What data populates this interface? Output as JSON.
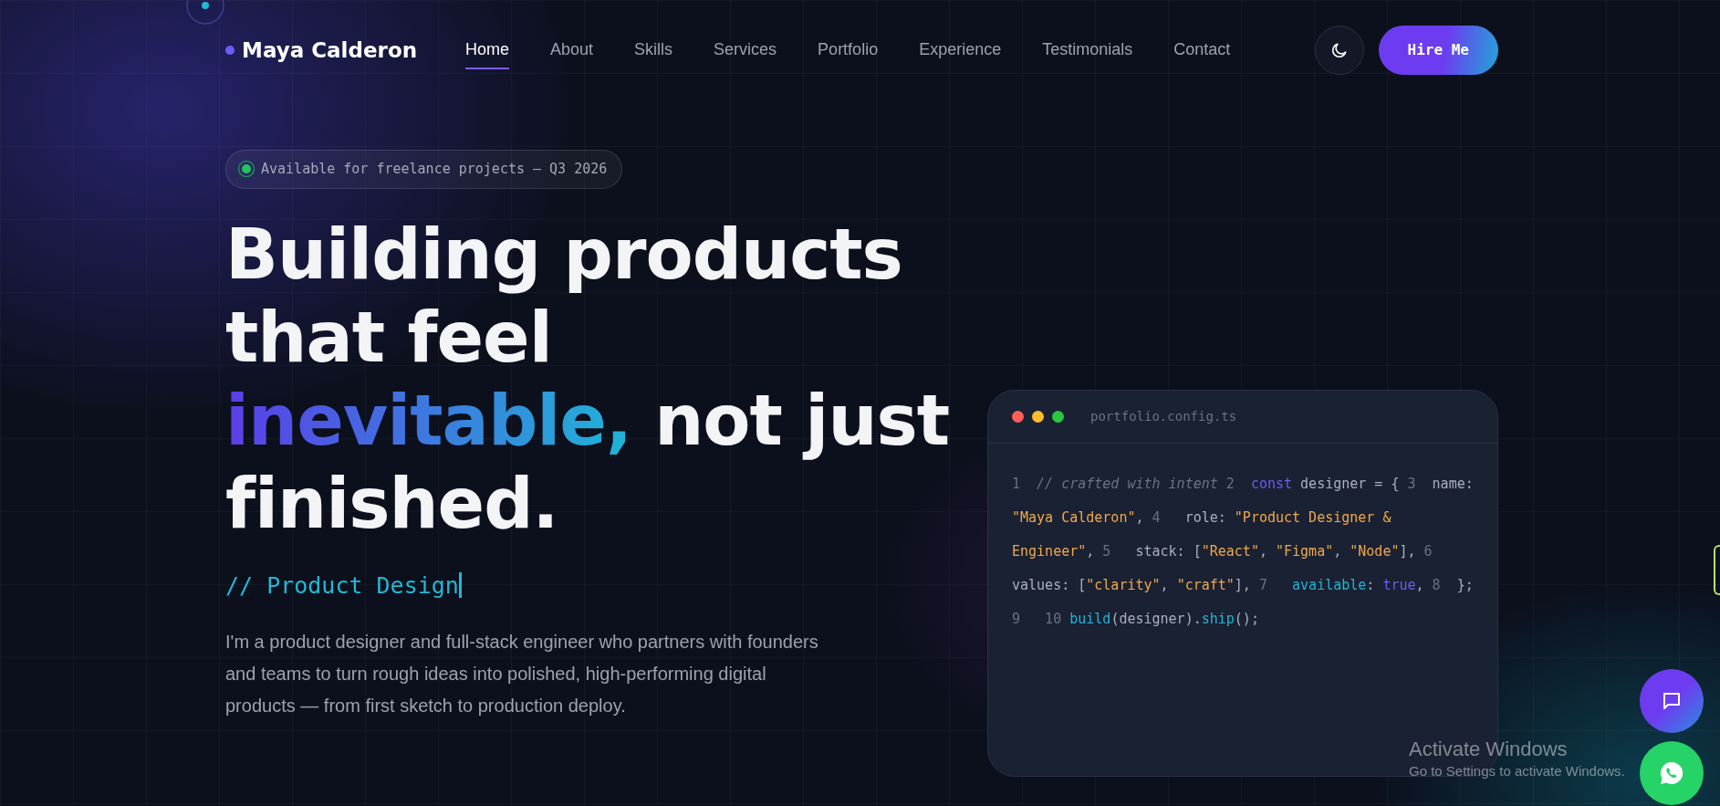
{
  "brand": {
    "name": "Maya Calderon"
  },
  "nav": [
    {
      "label": "Home",
      "selected": true
    },
    {
      "label": "About",
      "selected": false
    },
    {
      "label": "Skills",
      "selected": false
    },
    {
      "label": "Services",
      "selected": false
    },
    {
      "label": "Portfolio",
      "selected": false
    },
    {
      "label": "Experience",
      "selected": false
    },
    {
      "label": "Testimonials",
      "selected": false
    },
    {
      "label": "Contact",
      "selected": false
    }
  ],
  "cta": {
    "label": "Hire Me"
  },
  "hero": {
    "badge": "Available for freelance projects — Q3 2026",
    "heading": [
      [
        {
          "kind": "plain",
          "text": "Building products"
        }
      ],
      [
        {
          "kind": "plain",
          "text": "that feel"
        }
      ],
      [
        {
          "kind": "gradient",
          "text": "inevitable,"
        },
        {
          "kind": "plain",
          "text": " not just"
        }
      ],
      [
        {
          "kind": "plain",
          "text": "finished."
        }
      ]
    ],
    "typed": "// Product Design",
    "intro": "I'm a product designer and full-stack engineer who partners with founders and teams to turn rough ideas into polished, high-performing digital products — from first sketch to production deploy."
  },
  "editor": {
    "filename": "portfolio.config.ts",
    "tokens": [
      {
        "kind": "lineno",
        "text": "1 "
      },
      {
        "kind": "comment",
        "text": " // crafted with intent"
      },
      {
        "kind": "lineno",
        "text": " 2 "
      },
      {
        "kind": "keyword",
        "text": " const"
      },
      {
        "kind": "plain",
        "text": " designer = {"
      },
      {
        "kind": "lineno",
        "text": " 3 "
      },
      {
        "kind": "plain",
        "text": " name: "
      },
      {
        "kind": "string",
        "text": "\"Maya Calderon\""
      },
      {
        "kind": "plain",
        "text": ","
      },
      {
        "kind": "lineno",
        "text": " 4 "
      },
      {
        "kind": "plain",
        "text": "  role: "
      },
      {
        "kind": "string",
        "text": "\"Product Designer & Engineer\""
      },
      {
        "kind": "plain",
        "text": ","
      },
      {
        "kind": "lineno",
        "text": " 5 "
      },
      {
        "kind": "plain",
        "text": "  stack: ["
      },
      {
        "kind": "string",
        "text": "\"React\""
      },
      {
        "kind": "plain",
        "text": ", "
      },
      {
        "kind": "string",
        "text": "\"Figma\""
      },
      {
        "kind": "plain",
        "text": ", "
      },
      {
        "kind": "string",
        "text": "\"Node\""
      },
      {
        "kind": "plain",
        "text": "],"
      },
      {
        "kind": "lineno",
        "text": " 6 "
      },
      {
        "kind": "plain",
        "text": "  values: ["
      },
      {
        "kind": "string",
        "text": "\"clarity\""
      },
      {
        "kind": "plain",
        "text": ", "
      },
      {
        "kind": "string",
        "text": "\"craft\""
      },
      {
        "kind": "plain",
        "text": "],"
      },
      {
        "kind": "lineno",
        "text": " 7 "
      },
      {
        "kind": "func",
        "text": "  available"
      },
      {
        "kind": "plain",
        "text": ": "
      },
      {
        "kind": "keyword",
        "text": "true"
      },
      {
        "kind": "plain",
        "text": ","
      },
      {
        "kind": "lineno",
        "text": " 8 "
      },
      {
        "kind": "plain",
        "text": " };"
      },
      {
        "kind": "lineno",
        "text": " 9 "
      },
      {
        "kind": "lineno",
        "text": "  10 "
      },
      {
        "kind": "func",
        "text": "build"
      },
      {
        "kind": "plain",
        "text": "(designer)."
      },
      {
        "kind": "func",
        "text": "ship"
      },
      {
        "kind": "plain",
        "text": "();"
      }
    ]
  },
  "os_notice": {
    "title": "Activate Windows",
    "text": "Go to Settings to activate Windows."
  }
}
